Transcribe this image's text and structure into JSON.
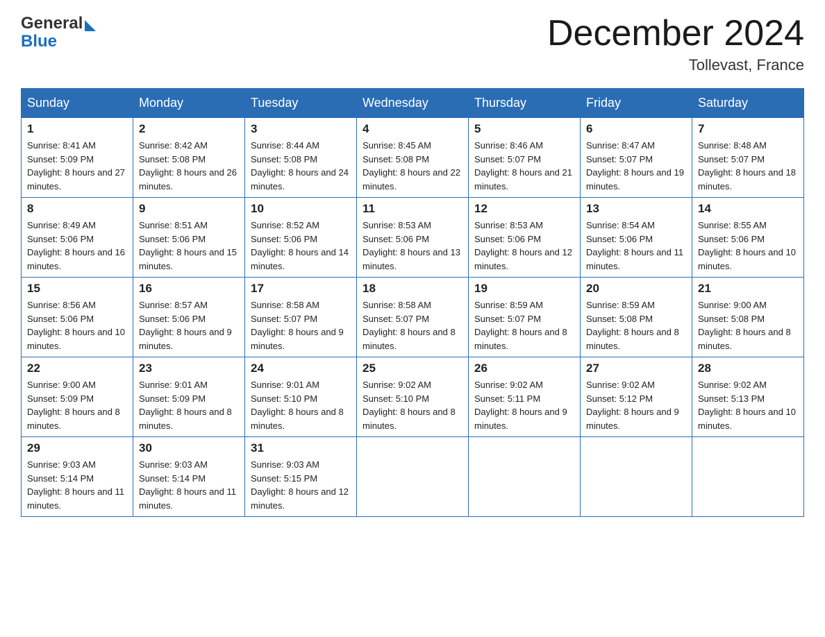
{
  "header": {
    "logo_general": "General",
    "logo_blue": "Blue",
    "title": "December 2024",
    "subtitle": "Tollevast, France"
  },
  "calendar": {
    "days_of_week": [
      "Sunday",
      "Monday",
      "Tuesday",
      "Wednesday",
      "Thursday",
      "Friday",
      "Saturday"
    ],
    "weeks": [
      [
        {
          "day": "1",
          "sunrise": "Sunrise: 8:41 AM",
          "sunset": "Sunset: 5:09 PM",
          "daylight": "Daylight: 8 hours and 27 minutes."
        },
        {
          "day": "2",
          "sunrise": "Sunrise: 8:42 AM",
          "sunset": "Sunset: 5:08 PM",
          "daylight": "Daylight: 8 hours and 26 minutes."
        },
        {
          "day": "3",
          "sunrise": "Sunrise: 8:44 AM",
          "sunset": "Sunset: 5:08 PM",
          "daylight": "Daylight: 8 hours and 24 minutes."
        },
        {
          "day": "4",
          "sunrise": "Sunrise: 8:45 AM",
          "sunset": "Sunset: 5:08 PM",
          "daylight": "Daylight: 8 hours and 22 minutes."
        },
        {
          "day": "5",
          "sunrise": "Sunrise: 8:46 AM",
          "sunset": "Sunset: 5:07 PM",
          "daylight": "Daylight: 8 hours and 21 minutes."
        },
        {
          "day": "6",
          "sunrise": "Sunrise: 8:47 AM",
          "sunset": "Sunset: 5:07 PM",
          "daylight": "Daylight: 8 hours and 19 minutes."
        },
        {
          "day": "7",
          "sunrise": "Sunrise: 8:48 AM",
          "sunset": "Sunset: 5:07 PM",
          "daylight": "Daylight: 8 hours and 18 minutes."
        }
      ],
      [
        {
          "day": "8",
          "sunrise": "Sunrise: 8:49 AM",
          "sunset": "Sunset: 5:06 PM",
          "daylight": "Daylight: 8 hours and 16 minutes."
        },
        {
          "day": "9",
          "sunrise": "Sunrise: 8:51 AM",
          "sunset": "Sunset: 5:06 PM",
          "daylight": "Daylight: 8 hours and 15 minutes."
        },
        {
          "day": "10",
          "sunrise": "Sunrise: 8:52 AM",
          "sunset": "Sunset: 5:06 PM",
          "daylight": "Daylight: 8 hours and 14 minutes."
        },
        {
          "day": "11",
          "sunrise": "Sunrise: 8:53 AM",
          "sunset": "Sunset: 5:06 PM",
          "daylight": "Daylight: 8 hours and 13 minutes."
        },
        {
          "day": "12",
          "sunrise": "Sunrise: 8:53 AM",
          "sunset": "Sunset: 5:06 PM",
          "daylight": "Daylight: 8 hours and 12 minutes."
        },
        {
          "day": "13",
          "sunrise": "Sunrise: 8:54 AM",
          "sunset": "Sunset: 5:06 PM",
          "daylight": "Daylight: 8 hours and 11 minutes."
        },
        {
          "day": "14",
          "sunrise": "Sunrise: 8:55 AM",
          "sunset": "Sunset: 5:06 PM",
          "daylight": "Daylight: 8 hours and 10 minutes."
        }
      ],
      [
        {
          "day": "15",
          "sunrise": "Sunrise: 8:56 AM",
          "sunset": "Sunset: 5:06 PM",
          "daylight": "Daylight: 8 hours and 10 minutes."
        },
        {
          "day": "16",
          "sunrise": "Sunrise: 8:57 AM",
          "sunset": "Sunset: 5:06 PM",
          "daylight": "Daylight: 8 hours and 9 minutes."
        },
        {
          "day": "17",
          "sunrise": "Sunrise: 8:58 AM",
          "sunset": "Sunset: 5:07 PM",
          "daylight": "Daylight: 8 hours and 9 minutes."
        },
        {
          "day": "18",
          "sunrise": "Sunrise: 8:58 AM",
          "sunset": "Sunset: 5:07 PM",
          "daylight": "Daylight: 8 hours and 8 minutes."
        },
        {
          "day": "19",
          "sunrise": "Sunrise: 8:59 AM",
          "sunset": "Sunset: 5:07 PM",
          "daylight": "Daylight: 8 hours and 8 minutes."
        },
        {
          "day": "20",
          "sunrise": "Sunrise: 8:59 AM",
          "sunset": "Sunset: 5:08 PM",
          "daylight": "Daylight: 8 hours and 8 minutes."
        },
        {
          "day": "21",
          "sunrise": "Sunrise: 9:00 AM",
          "sunset": "Sunset: 5:08 PM",
          "daylight": "Daylight: 8 hours and 8 minutes."
        }
      ],
      [
        {
          "day": "22",
          "sunrise": "Sunrise: 9:00 AM",
          "sunset": "Sunset: 5:09 PM",
          "daylight": "Daylight: 8 hours and 8 minutes."
        },
        {
          "day": "23",
          "sunrise": "Sunrise: 9:01 AM",
          "sunset": "Sunset: 5:09 PM",
          "daylight": "Daylight: 8 hours and 8 minutes."
        },
        {
          "day": "24",
          "sunrise": "Sunrise: 9:01 AM",
          "sunset": "Sunset: 5:10 PM",
          "daylight": "Daylight: 8 hours and 8 minutes."
        },
        {
          "day": "25",
          "sunrise": "Sunrise: 9:02 AM",
          "sunset": "Sunset: 5:10 PM",
          "daylight": "Daylight: 8 hours and 8 minutes."
        },
        {
          "day": "26",
          "sunrise": "Sunrise: 9:02 AM",
          "sunset": "Sunset: 5:11 PM",
          "daylight": "Daylight: 8 hours and 9 minutes."
        },
        {
          "day": "27",
          "sunrise": "Sunrise: 9:02 AM",
          "sunset": "Sunset: 5:12 PM",
          "daylight": "Daylight: 8 hours and 9 minutes."
        },
        {
          "day": "28",
          "sunrise": "Sunrise: 9:02 AM",
          "sunset": "Sunset: 5:13 PM",
          "daylight": "Daylight: 8 hours and 10 minutes."
        }
      ],
      [
        {
          "day": "29",
          "sunrise": "Sunrise: 9:03 AM",
          "sunset": "Sunset: 5:14 PM",
          "daylight": "Daylight: 8 hours and 11 minutes."
        },
        {
          "day": "30",
          "sunrise": "Sunrise: 9:03 AM",
          "sunset": "Sunset: 5:14 PM",
          "daylight": "Daylight: 8 hours and 11 minutes."
        },
        {
          "day": "31",
          "sunrise": "Sunrise: 9:03 AM",
          "sunset": "Sunset: 5:15 PM",
          "daylight": "Daylight: 8 hours and 12 minutes."
        },
        null,
        null,
        null,
        null
      ]
    ]
  }
}
